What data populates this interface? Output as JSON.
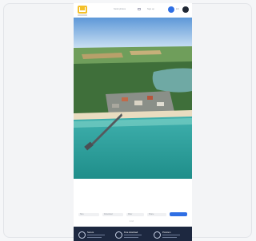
{
  "header": {
    "brand_icon": "house-logo-icon",
    "nav_links": [
      "Stock photos",
      "Sign up"
    ],
    "cart_icon": "cart-icon",
    "language": "EN"
  },
  "photo": {
    "subject_icon": "aerial-pier-beach-photo"
  },
  "toolbar": {
    "fields": [
      "Size",
      "Download",
      "Filter",
      "Share"
    ],
    "button_color": "#2f6fe4"
  },
  "pager": {
    "text": "1 / 2"
  },
  "footer": {
    "items": [
      {
        "icon": "shield-icon",
        "title": "Secure"
      },
      {
        "icon": "download-icon",
        "title": "Free download"
      },
      {
        "icon": "star-icon",
        "title": "Premium"
      }
    ],
    "background": "#1d2840"
  }
}
